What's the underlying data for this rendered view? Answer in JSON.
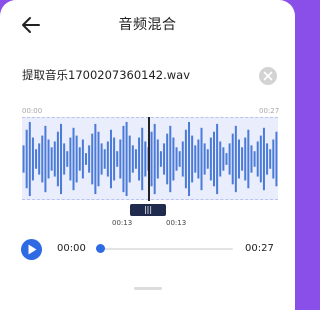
{
  "header": {
    "title": "音频混合",
    "back_icon": "arrow-left-icon"
  },
  "file": {
    "name": "提取音乐1700207360142.wav",
    "close_icon": "close-circle-icon"
  },
  "waveform": {
    "start_label": "00:00",
    "end_label": "00:27",
    "bar_color": "#4a7bd8",
    "background": "#eaedfb",
    "amplitudes": [
      0.35,
      0.75,
      0.95,
      0.55,
      0.25,
      0.4,
      0.6,
      0.85,
      0.5,
      0.3,
      0.45,
      0.7,
      0.9,
      0.4,
      0.2,
      0.55,
      0.8,
      0.6,
      0.3,
      0.5,
      0.15,
      0.35,
      0.65,
      0.9,
      0.7,
      0.4,
      0.25,
      0.45,
      0.75,
      0.55,
      0.2,
      0.5,
      0.85,
      0.95,
      0.6,
      0.35,
      0.25,
      0.55,
      0.8,
      0.45,
      0.3,
      0.7,
      0.9,
      0.5,
      0.2,
      0.4,
      0.65,
      0.85,
      0.55,
      0.3,
      0.2,
      0.45,
      0.75,
      0.95,
      0.6,
      0.35,
      0.5,
      0.8,
      0.4,
      0.25,
      0.55,
      0.7,
      0.9,
      0.45,
      0.3,
      0.15,
      0.4,
      0.65,
      0.85,
      0.5,
      0.3,
      0.55,
      0.75,
      0.35,
      0.2,
      0.45,
      0.6,
      0.8,
      0.4,
      0.25,
      0.5,
      0.7
    ]
  },
  "marker": {
    "grip_label": "|||",
    "left_time": "00:13",
    "right_time": "00:13"
  },
  "player": {
    "play_icon": "play-icon",
    "current_time": "00:00",
    "total_time": "00:27",
    "progress": 0.0,
    "accent": "#2d6ae3"
  },
  "bottom": {
    "handle_icon": "bottom-sheet-handle"
  }
}
